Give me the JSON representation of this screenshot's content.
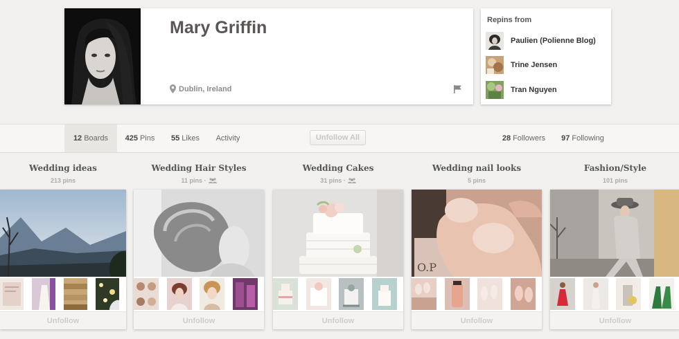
{
  "profile": {
    "name": "Mary Griffin",
    "location": "Dublin, Ireland"
  },
  "repins": {
    "title": "Repins from",
    "users": [
      {
        "name": "Paulien (Polienne Blog)"
      },
      {
        "name": "Trine Jensen"
      },
      {
        "name": "Tran Nguyen"
      }
    ]
  },
  "nav": {
    "boards": {
      "count": "12",
      "label": "Boards"
    },
    "pins": {
      "count": "425",
      "label": "Pins"
    },
    "likes": {
      "count": "55",
      "label": "Likes"
    },
    "activity": {
      "label": "Activity"
    },
    "unfollow_all": "Unfollow All",
    "followers": {
      "count": "28",
      "label": "Followers"
    },
    "following": {
      "count": "97",
      "label": "Following"
    }
  },
  "boards": [
    {
      "title": "Wedding ideas",
      "pins": "213 pins",
      "group": false,
      "unfollow": "Unfollow"
    },
    {
      "title": "Wedding Hair Styles",
      "pins": "11 pins ·",
      "group": true,
      "unfollow": "Unfollow"
    },
    {
      "title": "Wedding Cakes",
      "pins": "31 pins ·",
      "group": true,
      "unfollow": "Unfollow"
    },
    {
      "title": "Wedding nail looks",
      "pins": "5 pins",
      "group": false,
      "unfollow": "Unfollow"
    },
    {
      "title": "Fashion/Style",
      "pins": "101 pins",
      "group": false,
      "unfollow": "Unfollow"
    }
  ],
  "icons": {
    "location": "map-pin-icon",
    "flag": "flag-icon",
    "group": "group-board-icon"
  }
}
